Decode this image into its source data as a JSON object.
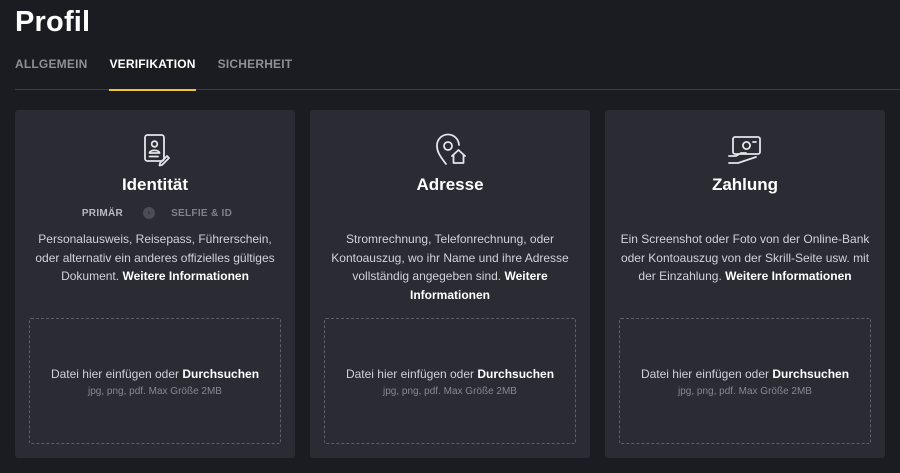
{
  "page": {
    "title": "Profil"
  },
  "tabs": [
    {
      "label": "ALLGEMEIN",
      "active": false
    },
    {
      "label": "VERIFIKATION",
      "active": true
    },
    {
      "label": "SICHERHEIT",
      "active": false
    }
  ],
  "colors": {
    "background": "#1b1c21",
    "card": "#2a2b33",
    "accent": "#f2c230",
    "text": "#ffffff",
    "muted": "#8e9098"
  },
  "cards": [
    {
      "icon": "id-document-icon",
      "title": "Identität",
      "steps": {
        "primary": "PRIMÄR",
        "arrow": "›",
        "secondary": "SELFIE & ID"
      },
      "description": "Personalausweis, Reisepass, Führerschein, oder alternativ ein anderes offizielles gültiges Dokument.",
      "more_link": "Weitere Informationen",
      "dropzone": {
        "text": "Datei hier einfügen oder",
        "browse": "Durchsuchen",
        "hint": "jpg, png, pdf. Max Größe 2MB"
      }
    },
    {
      "icon": "location-home-icon",
      "title": "Adresse",
      "description": "Stromrechnung, Telefonrechnung, oder Kontoauszug, wo ihr Name und ihre Adresse vollständig angegeben sind.",
      "more_link": "Weitere Informationen",
      "dropzone": {
        "text": "Datei hier einfügen oder",
        "browse": "Durchsuchen",
        "hint": "jpg, png, pdf. Max Größe 2MB"
      }
    },
    {
      "icon": "payment-card-icon",
      "title": "Zahlung",
      "description": "Ein Screenshot oder Foto von der Online-Bank oder Kontoauszug von der Skrill-Seite usw. mit der Einzahlung.",
      "more_link": "Weitere Informationen",
      "dropzone": {
        "text": "Datei hier einfügen oder",
        "browse": "Durchsuchen",
        "hint": "jpg, png, pdf. Max Größe 2MB"
      }
    }
  ]
}
